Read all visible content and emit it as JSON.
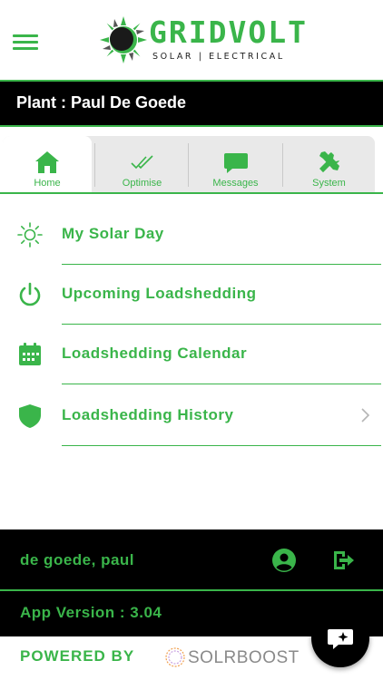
{
  "brand": {
    "name": "GRIDVOLT",
    "tagline": "SOLAR | ELECTRICAL",
    "accent_color": "#3ab54a"
  },
  "header": {
    "menu_icon": "hamburger-icon"
  },
  "plant": {
    "label": "Plant : Paul De Goede"
  },
  "tabs": [
    {
      "label": "Home",
      "icon": "home-icon",
      "active": true
    },
    {
      "label": "Optimise",
      "icon": "double-check-icon",
      "active": false
    },
    {
      "label": "Messages",
      "icon": "chat-bubble-icon",
      "active": false
    },
    {
      "label": "System",
      "icon": "tools-icon",
      "active": false
    }
  ],
  "menu": [
    {
      "label": "My Solar Day",
      "icon": "sun-icon"
    },
    {
      "label": "Upcoming Loadshedding",
      "icon": "power-icon"
    },
    {
      "label": "Loadshedding Calendar",
      "icon": "calendar-icon"
    },
    {
      "label": "Loadshedding History",
      "icon": "shield-icon",
      "chevron": true
    }
  ],
  "footer": {
    "user_name": "de goede, paul",
    "app_version": "App Version : 3.04"
  },
  "powered": {
    "label": "POWERED BY",
    "partner": "SOLRBOOST"
  }
}
